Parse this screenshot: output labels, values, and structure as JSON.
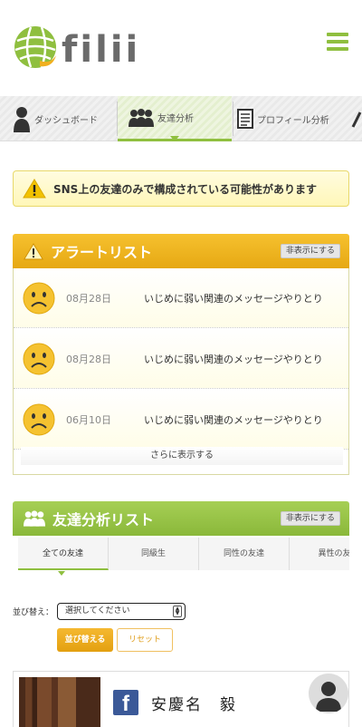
{
  "header": {
    "logo_text": "filii",
    "menu_icon": "hamburger-icon"
  },
  "tabs": [
    {
      "label": "ダッシュボード",
      "icon": "person-icon"
    },
    {
      "label": "友達分析",
      "icon": "group-icon",
      "active": true
    },
    {
      "label": "プロフィール分析",
      "icon": "document-icon"
    }
  ],
  "warning": {
    "text": "SNS上の友達のみで構成されている可能性があります",
    "icon": "warning-icon"
  },
  "alerts": {
    "title": "アラートリスト",
    "hide_label": "非表示にする",
    "rows": [
      {
        "date": "08月28日",
        "message": "いじめに弱い関連のメッセージやりとり"
      },
      {
        "date": "08月28日",
        "message": "いじめに弱い関連のメッセージやりとり"
      },
      {
        "date": "06月10日",
        "message": "いじめに弱い関連のメッセージやりとり"
      }
    ],
    "more_label": "さらに表示する"
  },
  "friends": {
    "title": "友達分析リスト",
    "hide_label": "非表示にする",
    "subtabs": [
      "全ての友達",
      "同級生",
      "同性の友達",
      "異性の友"
    ],
    "sort_label": "並び替え：",
    "sort_select": "選択してください",
    "sort_button": "並び替える",
    "reset_button": "リセット",
    "card": {
      "name": "安慶名　毅"
    }
  },
  "colors": {
    "accent_green": "#8fbf3f",
    "accent_orange": "#f0b020",
    "facebook": "#3b5998"
  }
}
